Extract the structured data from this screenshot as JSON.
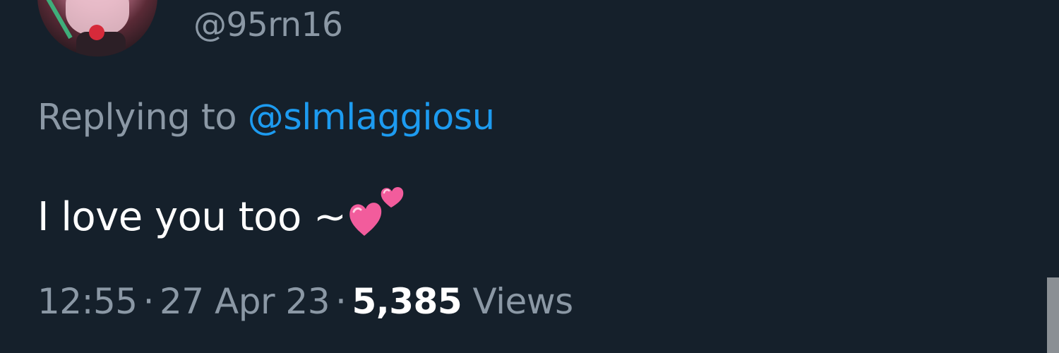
{
  "tweet": {
    "handle": "@95rn16",
    "replying_prefix": "Replying to ",
    "replying_to": "@slmlaggiosu",
    "text": "I love you too ~",
    "emoji": "two-hearts-icon",
    "time": "12:55",
    "separator": "·",
    "date": "27 Apr 23",
    "views_count": "5,385",
    "views_label": "Views"
  },
  "colors": {
    "background": "#15202b",
    "secondary_text": "#8b98a5",
    "link": "#1d9bf0",
    "primary_text": "#ffffff",
    "heart": "#f25c9c"
  }
}
